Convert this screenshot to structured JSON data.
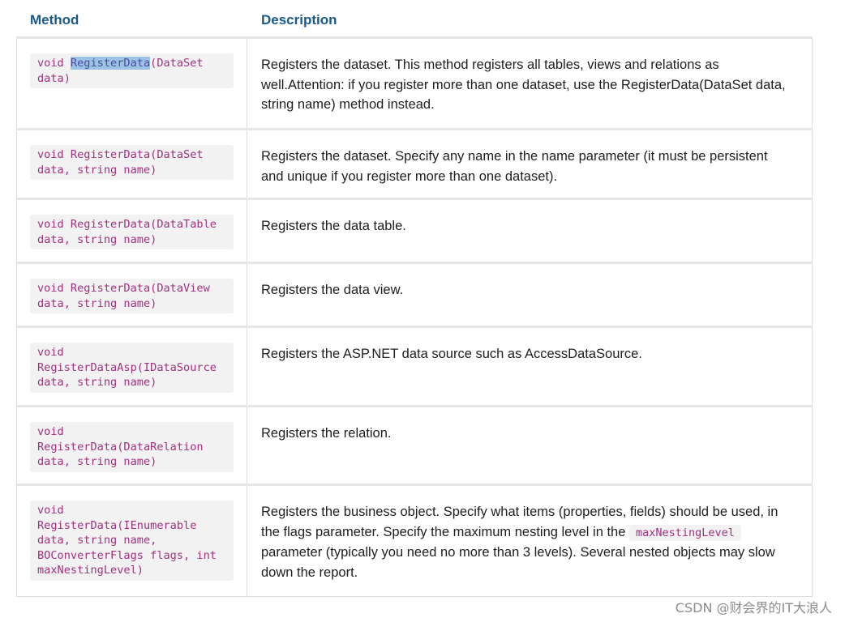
{
  "header": {
    "method_label": "Method",
    "description_label": "Description"
  },
  "rows": [
    {
      "code": [
        "void ",
        "RegisterData",
        "(DataSet",
        "data)"
      ],
      "description": "Registers the dataset. This method registers all tables, views and relations as well.Attention: if you register more than one dataset, use the RegisterData(DataSet data, string name) method instead."
    },
    {
      "code": [
        "void RegisterData(DataSet",
        "data, string name)"
      ],
      "description": "Registers the dataset. Specify any name in the name parameter (it must be persistent and unique if you register more than one dataset)."
    },
    {
      "code": [
        "void RegisterData(DataTable",
        "data, string name)"
      ],
      "description": "Registers the data table."
    },
    {
      "code": [
        "void RegisterData(DataView",
        "data, string name)"
      ],
      "description": "Registers the data view."
    },
    {
      "code": [
        "void",
        "RegisterDataAsp(IDataSource",
        "data, string name)"
      ],
      "description": "Registers the ASP.NET data source such as AccessDataSource."
    },
    {
      "code": [
        "void",
        "RegisterData(DataRelation",
        "data, string name)"
      ],
      "description": "Registers the relation."
    },
    {
      "code": [
        "void",
        "RegisterData(IEnumerable",
        "data, string name,",
        "BOConverterFlags flags, int",
        "maxNestingLevel)"
      ],
      "description_before": "Registers the business object. Specify what items (properties, fields) should be used, in the flags parameter. Specify the maximum nesting level in the ",
      "description_code": "maxNestingLevel",
      "description_after": " parameter (typically you need no more than 3 levels). Several nested objects may slow down the report."
    }
  ],
  "watermark": "CSDN @财会界的IT大浪人"
}
